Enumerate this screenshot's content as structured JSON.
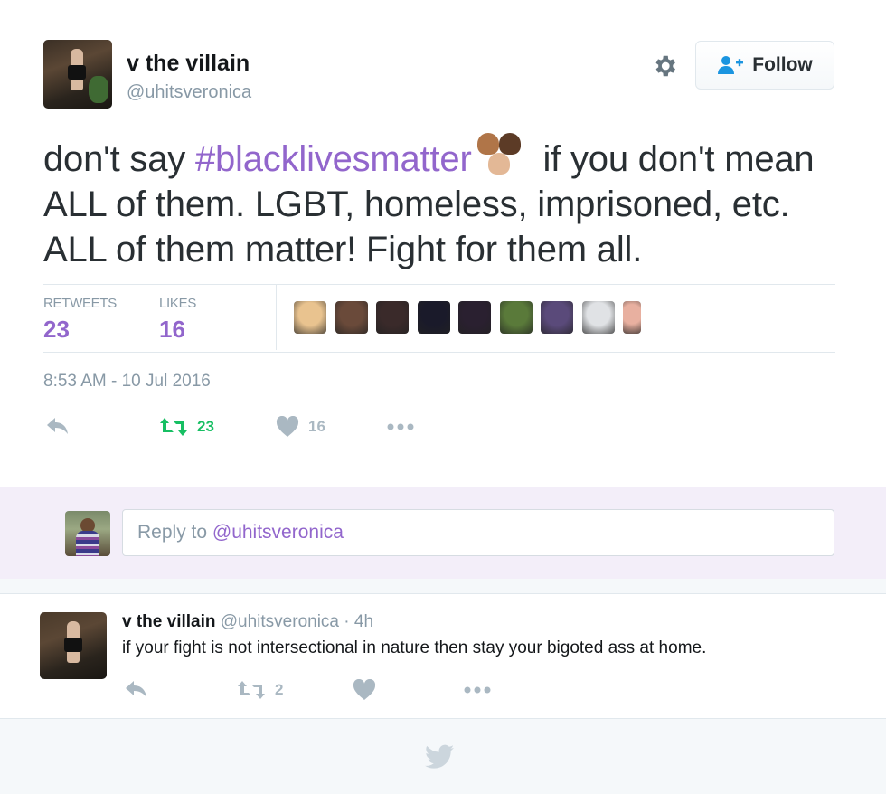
{
  "tweet": {
    "user": {
      "name": "v the villain",
      "handle": "@uhitsveronica"
    },
    "follow_label": "Follow",
    "text": {
      "part1": "don't say ",
      "hashtag": "#blacklivesmatter",
      "part2": " if you don't mean ALL of them. LGBT, homeless, imprisoned, etc. ALL of them matter! Fight for them all."
    },
    "stats": {
      "retweets_label": "RETWEETS",
      "retweets": "23",
      "likes_label": "LIKES",
      "likes": "16"
    },
    "timestamp": "8:53 AM - 10 Jul 2016",
    "actions": {
      "retweet_count": "23",
      "like_count": "16"
    }
  },
  "liker_avatars": [
    "#e9c38f",
    "#6a4a3a",
    "#3a2a2a",
    "#1a1a2a",
    "#2a2030",
    "#5a7a3a",
    "#5a4a7a",
    "#e0e2e5",
    "#e8b0a0"
  ],
  "reply_box": {
    "placeholder_prefix": "Reply to ",
    "placeholder_mention": "@uhitsveronica"
  },
  "reply": {
    "name": "v the villain",
    "meta": "@uhitsveronica · 4h",
    "text": "if your fight is not intersectional in nature then stay your bigoted ass at home.",
    "retweet_count": "2"
  },
  "colors": {
    "accent": "#9266cc",
    "retweet_green": "#17bf63",
    "icon_gray": "#aab8c2"
  }
}
